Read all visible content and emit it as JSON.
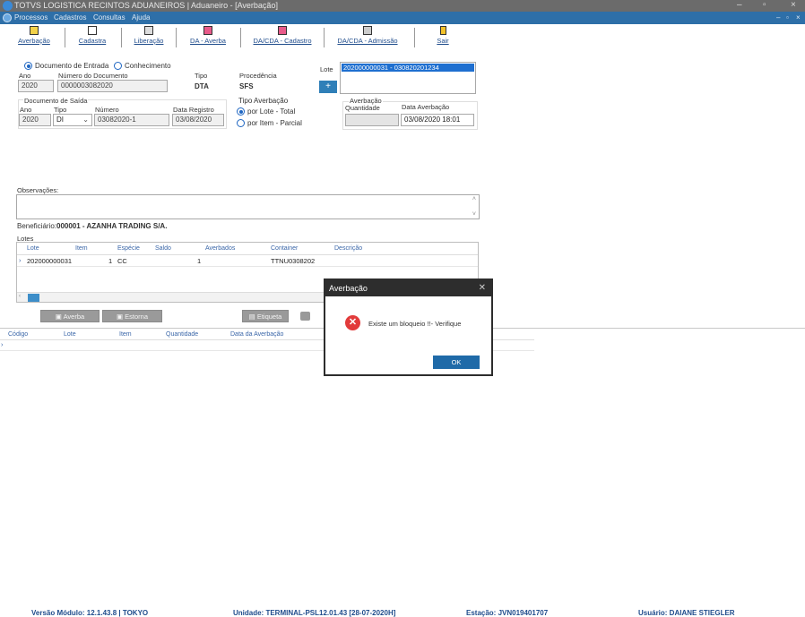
{
  "window": {
    "title": "TOTVS LOGISTICA RECINTOS ADUANEIROS | Aduaneiro - [Averbação]"
  },
  "menu": [
    "Processos",
    "Cadastros",
    "Consultas",
    "Ajuda"
  ],
  "toolbar": [
    {
      "label": "Averbação",
      "icon": "document-icon"
    },
    {
      "label": "Cadastra",
      "icon": "page-icon"
    },
    {
      "label": "Liberação",
      "icon": "stamp-icon"
    },
    {
      "label": "DA - Averba",
      "icon": "house-icon"
    },
    {
      "label": "DA/CDA - Cadastro",
      "icon": "house-icon"
    },
    {
      "label": "DA/CDA - Admissão",
      "icon": "printer-icon"
    },
    {
      "label": "Sair",
      "icon": "exit-icon"
    }
  ],
  "form": {
    "doc_entrada": "Documento de Entrada",
    "conhecimento": "Conhecimento",
    "ano_label": "Ano",
    "ano": "2020",
    "num_doc_label": "Número do Documento",
    "num_doc": "0000003082020",
    "tipo_label": "Tipo",
    "tipo": "DTA",
    "procedencia_label": "Procedência",
    "procedencia": "SFS",
    "lote_label": "Lote",
    "lote_item": "202000000031 - 030820201234",
    "doc_saida_label": "Documento de Saída",
    "saida_ano_label": "Ano",
    "saida_ano": "2020",
    "saida_tipo_label": "Tipo",
    "saida_tipo": "DI",
    "saida_numero_label": "Número",
    "saida_numero": "03082020-1",
    "data_registro_label": "Data Registro",
    "data_registro": "03/08/2020",
    "tipo_averbacao_label": "Tipo Averbação",
    "por_lote": "por Lote - Total",
    "por_item": "por Item  - Parcial",
    "averbacao_label": "Averbação",
    "quantidade_label": "Quantidade",
    "data_averbacao_label": "Data Averbação",
    "data_averbacao": "03/08/2020 18:01",
    "observacoes_label": "Observações:",
    "beneficiario_label": "Beneficiário:",
    "beneficiario": "000001 - AZANHA TRADING S/A.",
    "lotes_label": "Lotes"
  },
  "lotes_table": {
    "columns": [
      "Lote",
      "Item",
      "Espécie",
      "Saldo",
      "Averbados",
      "Container",
      "Descrição"
    ],
    "rows": [
      {
        "lote": "202000000031",
        "item": "1",
        "especie": "CC",
        "saldo": "",
        "averbados": "1",
        "container": "TTNU0308202",
        "descricao": ""
      }
    ]
  },
  "buttons": {
    "averba": "Averba",
    "estorna": "Estorna",
    "etiqueta": "Etiqueta"
  },
  "bottom_table": {
    "columns": [
      "Código",
      "Lote",
      "Item",
      "Quantidade",
      "Data da Averbação"
    ]
  },
  "dialog": {
    "title": "Averbação",
    "message": "Existe um bloqueio !!- Verifique",
    "ok": "OK"
  },
  "status": {
    "versao": "Versão Módulo: 12.1.43.8 | TOKYO",
    "unidade": "Unidade: TERMINAL-PSL12.01.43 [28-07-2020H]",
    "estacao": "Estação: JVN019401707",
    "usuario": "Usuário: DAIANE STIEGLER"
  }
}
